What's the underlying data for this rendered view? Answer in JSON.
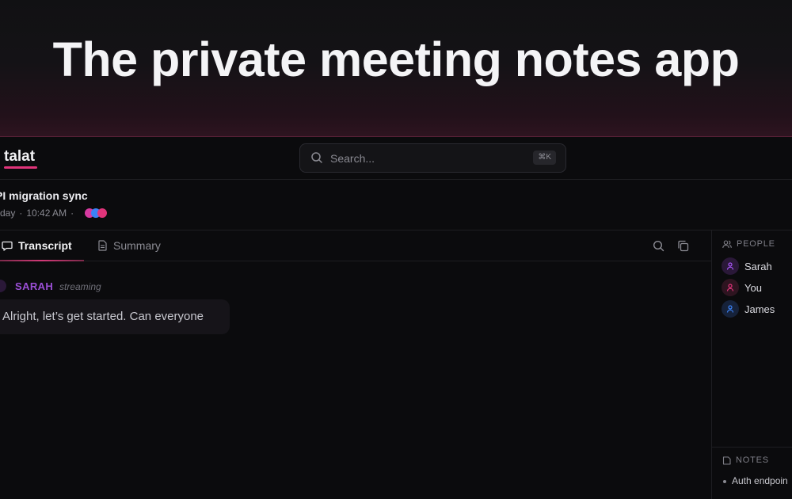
{
  "hero": {
    "headline": "The private meeting notes app"
  },
  "app": {
    "logo": "talat",
    "search": {
      "placeholder": "Search...",
      "shortcut": "⌘K"
    },
    "meeting": {
      "title": "PI migration sync",
      "date": "day",
      "time": "10:42 AM",
      "separator": "·",
      "participant_colors": [
        "#d63aa0",
        "#3b82f6",
        "#e0347a"
      ]
    },
    "tabs": [
      {
        "label": "Transcript",
        "icon": "chat-bubble-icon",
        "active": true
      },
      {
        "label": "Summary",
        "icon": "document-icon",
        "active": false
      }
    ],
    "toolbar": {
      "search_icon": "search-icon",
      "copy_icon": "copy-icon"
    },
    "transcript": {
      "entries": [
        {
          "speaker": "SARAH",
          "status": "streaming",
          "text": "Alright, let’s get started. Can everyone"
        }
      ]
    },
    "sidebar": {
      "people_heading": "PEOPLE",
      "people": [
        {
          "name": "Sarah",
          "color": "#a855f7",
          "bg": "#2a1838"
        },
        {
          "name": "You",
          "color": "#e0347a",
          "bg": "#2e1420"
        },
        {
          "name": "James",
          "color": "#3b82f6",
          "bg": "#16223a"
        }
      ],
      "notes_heading": "NOTES",
      "notes": [
        "Auth endpoin"
      ]
    },
    "colors": {
      "accent": "#e0347a",
      "speaker_accent": "#9b4fd6",
      "background": "#0b0b0d"
    }
  }
}
